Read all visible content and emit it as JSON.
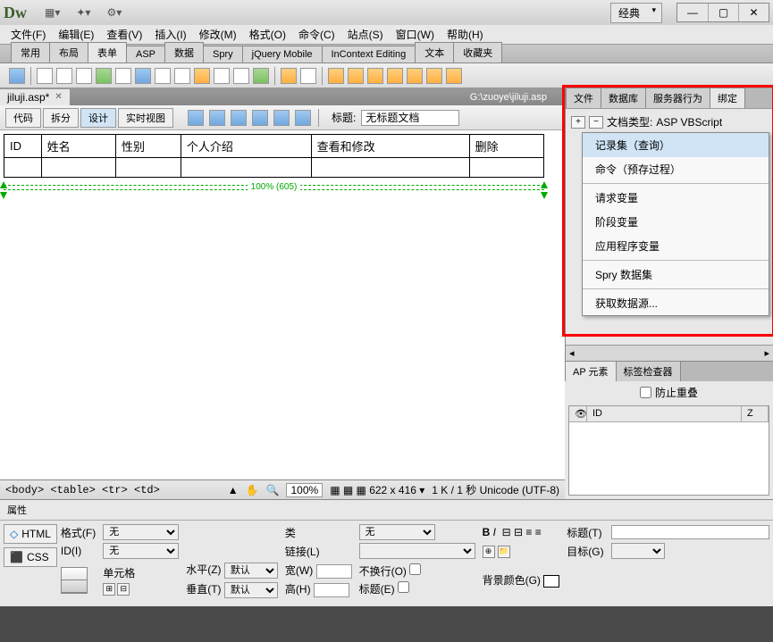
{
  "app": {
    "logo": "Dw",
    "preset": "经典"
  },
  "winbtns": {
    "min": "—",
    "max": "▢",
    "close": "✕"
  },
  "menu": [
    "文件(F)",
    "编辑(E)",
    "查看(V)",
    "插入(I)",
    "修改(M)",
    "格式(O)",
    "命令(C)",
    "站点(S)",
    "窗口(W)",
    "帮助(H)"
  ],
  "insert_tabs": [
    "常用",
    "布局",
    "表单",
    "ASP",
    "数据",
    "Spry",
    "jQuery Mobile",
    "InContext Editing",
    "文本",
    "收藏夹"
  ],
  "insert_tabs_active": 2,
  "doc": {
    "tab": "jiluji.asp*",
    "path": "G:\\zuoye\\jiluji.asp"
  },
  "view_buttons": [
    "代码",
    "拆分",
    "设计",
    "实时视图"
  ],
  "view_active": 2,
  "title_label": "标题:",
  "title_value": "无标题文档",
  "table_headers": [
    "ID",
    "姓名",
    "性别",
    "个人介绍",
    "查看和修改",
    "删除"
  ],
  "ruler_label": "100% (605)",
  "side_tabs": [
    "文件",
    "数据库",
    "服务器行为",
    "绑定"
  ],
  "side_active": 3,
  "doctype_label": "文档类型:",
  "doctype_value": "ASP VBScript",
  "ctx_menu": {
    "items1": [
      "记录集（查询）",
      "命令（预存过程）"
    ],
    "items2": [
      "请求变量",
      "阶段变量",
      "应用程序变量"
    ],
    "items3": [
      "Spry 数据集"
    ],
    "items4": [
      "获取数据源..."
    ]
  },
  "ctx_highlight": 0,
  "side_hint": "。",
  "side_hint2": "记录",
  "panel2_tabs": [
    "AP 元素",
    "标签检查器"
  ],
  "panel2_chk": "防止重叠",
  "panel2_cols": {
    "id": "ID",
    "z": "Z"
  },
  "status": {
    "tagpath": "<body> <table> <tr> <td>",
    "zoom": "100%",
    "dims": "622 x 416",
    "info": "1 K / 1 秒 Unicode (UTF-8)"
  },
  "props": {
    "title": "属性",
    "html": "HTML",
    "css": "CSS",
    "format_l": "格式(F)",
    "format_v": "无",
    "id_l": "ID(I)",
    "id_v": "无",
    "class_l": "类",
    "class_v": "无",
    "link_l": "链接(L)",
    "title_l": "标题(T)",
    "target_l": "目标(G)",
    "cell_l": "单元格",
    "horz_l": "水平(Z)",
    "horz_v": "默认",
    "vert_l": "垂直(T)",
    "vert_v": "默认",
    "w_l": "宽(W)",
    "h_l": "高(H)",
    "nowrap_l": "不换行(O)",
    "header_l": "标题(E)",
    "bg_l": "背景颜色(G)"
  }
}
